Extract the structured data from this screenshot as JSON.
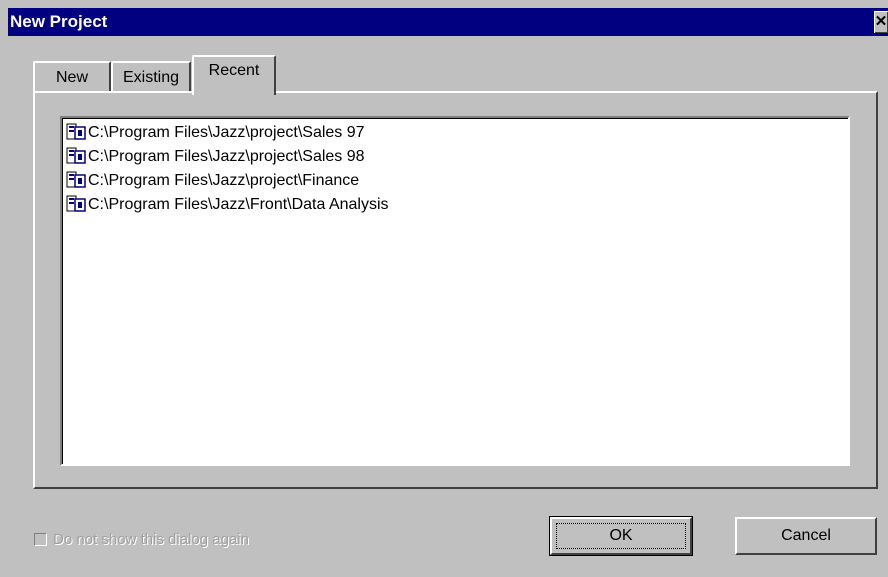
{
  "window": {
    "title": "New Project",
    "close_glyph": "✕"
  },
  "tabs": [
    {
      "label": "New",
      "selected": false
    },
    {
      "label": "Existing",
      "selected": false
    },
    {
      "label": "Recent",
      "selected": true
    }
  ],
  "recent_list": {
    "icon": "project-file-icon",
    "items": [
      "C:\\Program Files\\Jazz\\project\\Sales 97",
      "C:\\Program Files\\Jazz\\project\\Sales 98",
      "C:\\Program Files\\Jazz\\project\\Finance",
      "C:\\Program Files\\Jazz\\Front\\Data Analysis"
    ]
  },
  "footer": {
    "dont_show_label": "Do not show this dialog again",
    "dont_show_checked": false,
    "dont_show_enabled": false,
    "ok_label": "OK",
    "cancel_label": "Cancel"
  },
  "colors": {
    "titlebar": "#000080",
    "face": "#c0c0c0",
    "disabled_text": "#a0a0a0"
  }
}
